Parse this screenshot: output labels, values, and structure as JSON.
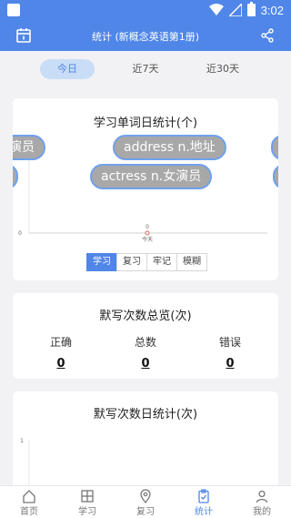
{
  "statusbar": {
    "time": "3:02"
  },
  "header": {
    "title": "统计 (新概念英语第1册)"
  },
  "tabs": [
    {
      "label": "今日"
    },
    {
      "label": "近7天"
    },
    {
      "label": "近30天"
    }
  ],
  "daily_words": {
    "title": "学习单词日统计(个)",
    "bubbles": [
      {
        "text": "男演员"
      },
      {
        "text": "address  n.地址"
      },
      {
        "text": "actress  n.女演员"
      }
    ],
    "segments": [
      {
        "label": "学习"
      },
      {
        "label": "复习"
      },
      {
        "label": "牢记"
      },
      {
        "label": "模糊"
      }
    ],
    "selected_segment": "学习"
  },
  "dictation_overview": {
    "title": "默写次数总览(次)",
    "stats": [
      {
        "label": "正确",
        "value": "0"
      },
      {
        "label": "总数",
        "value": "0"
      },
      {
        "label": "错误",
        "value": "0"
      }
    ]
  },
  "dictation_daily": {
    "title": "默写次数日统计(次)"
  },
  "chart_data": [
    {
      "type": "line",
      "title": "学习单词日统计(个)",
      "categories": [
        "今天"
      ],
      "series": [
        {
          "values": [
            0
          ]
        }
      ],
      "ylim": [
        0,
        0
      ]
    },
    {
      "type": "line",
      "title": "默写次数日统计(次)",
      "categories": [],
      "series": [],
      "ylim": [
        0,
        1
      ]
    }
  ],
  "bottomnav": [
    {
      "label": "首页",
      "icon": "home-icon"
    },
    {
      "label": "学习",
      "icon": "book-icon"
    },
    {
      "label": "复习",
      "icon": "location-pin-icon"
    },
    {
      "label": "统计",
      "icon": "clipboard-check-icon"
    },
    {
      "label": "我的",
      "icon": "person-icon"
    }
  ],
  "colors": {
    "accent": "#4f86e8",
    "bubble_bg": "#a8a8a8",
    "bubble_border": "#6fa0ef"
  }
}
